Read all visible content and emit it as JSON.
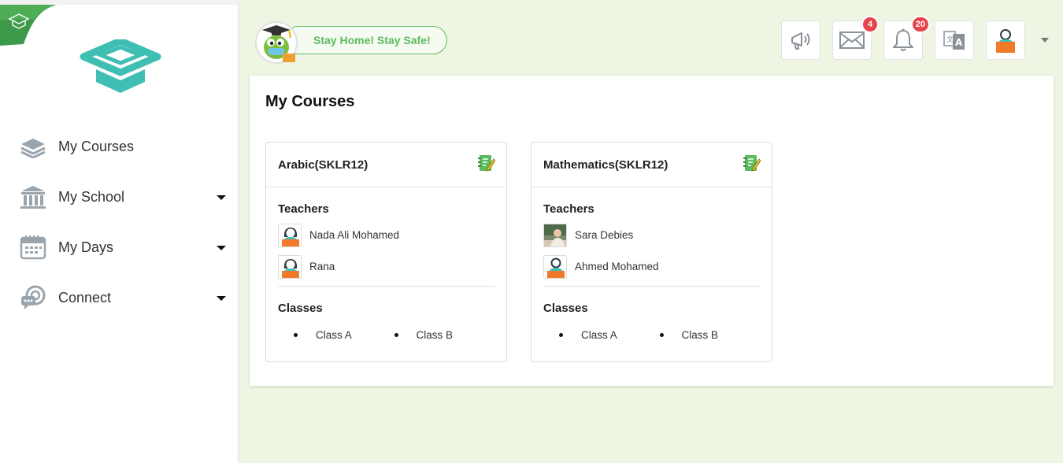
{
  "sidebar": {
    "items": [
      {
        "label": "My Courses",
        "icon": "book-stack-icon",
        "has_dropdown": false
      },
      {
        "label": "My School",
        "icon": "school-building-icon",
        "has_dropdown": true
      },
      {
        "label": "My Days",
        "icon": "calendar-icon",
        "has_dropdown": true
      },
      {
        "label": "Connect",
        "icon": "chat-connect-icon",
        "has_dropdown": true
      }
    ]
  },
  "header": {
    "banner_text": "Stay Home! Stay Safe!",
    "messages_count": "4",
    "notifications_count": "20"
  },
  "main": {
    "title": "My Courses",
    "courses": [
      {
        "title": "Arabic(SKLR12)",
        "teachers_label": "Teachers",
        "teachers": [
          {
            "name": "Nada Ali Mohamed",
            "avatar": "female-teacher-avatar"
          },
          {
            "name": "Rana",
            "avatar": "female-teacher-avatar"
          }
        ],
        "classes_label": "Classes",
        "classes": [
          "Class A",
          "Class B"
        ]
      },
      {
        "title": "Mathematics(SKLR12)",
        "teachers_label": "Teachers",
        "teachers": [
          {
            "name": "Sara Debies",
            "avatar": "photo-avatar"
          },
          {
            "name": "Ahmed Mohamed",
            "avatar": "male-teacher-avatar"
          }
        ],
        "classes_label": "Classes",
        "classes": [
          "Class A",
          "Class B"
        ]
      }
    ]
  },
  "colors": {
    "accent_green": "#5cbb5f",
    "logo_teal": "#3fbfb4",
    "badge_red": "#e8434a",
    "background": "#eef6e3"
  }
}
